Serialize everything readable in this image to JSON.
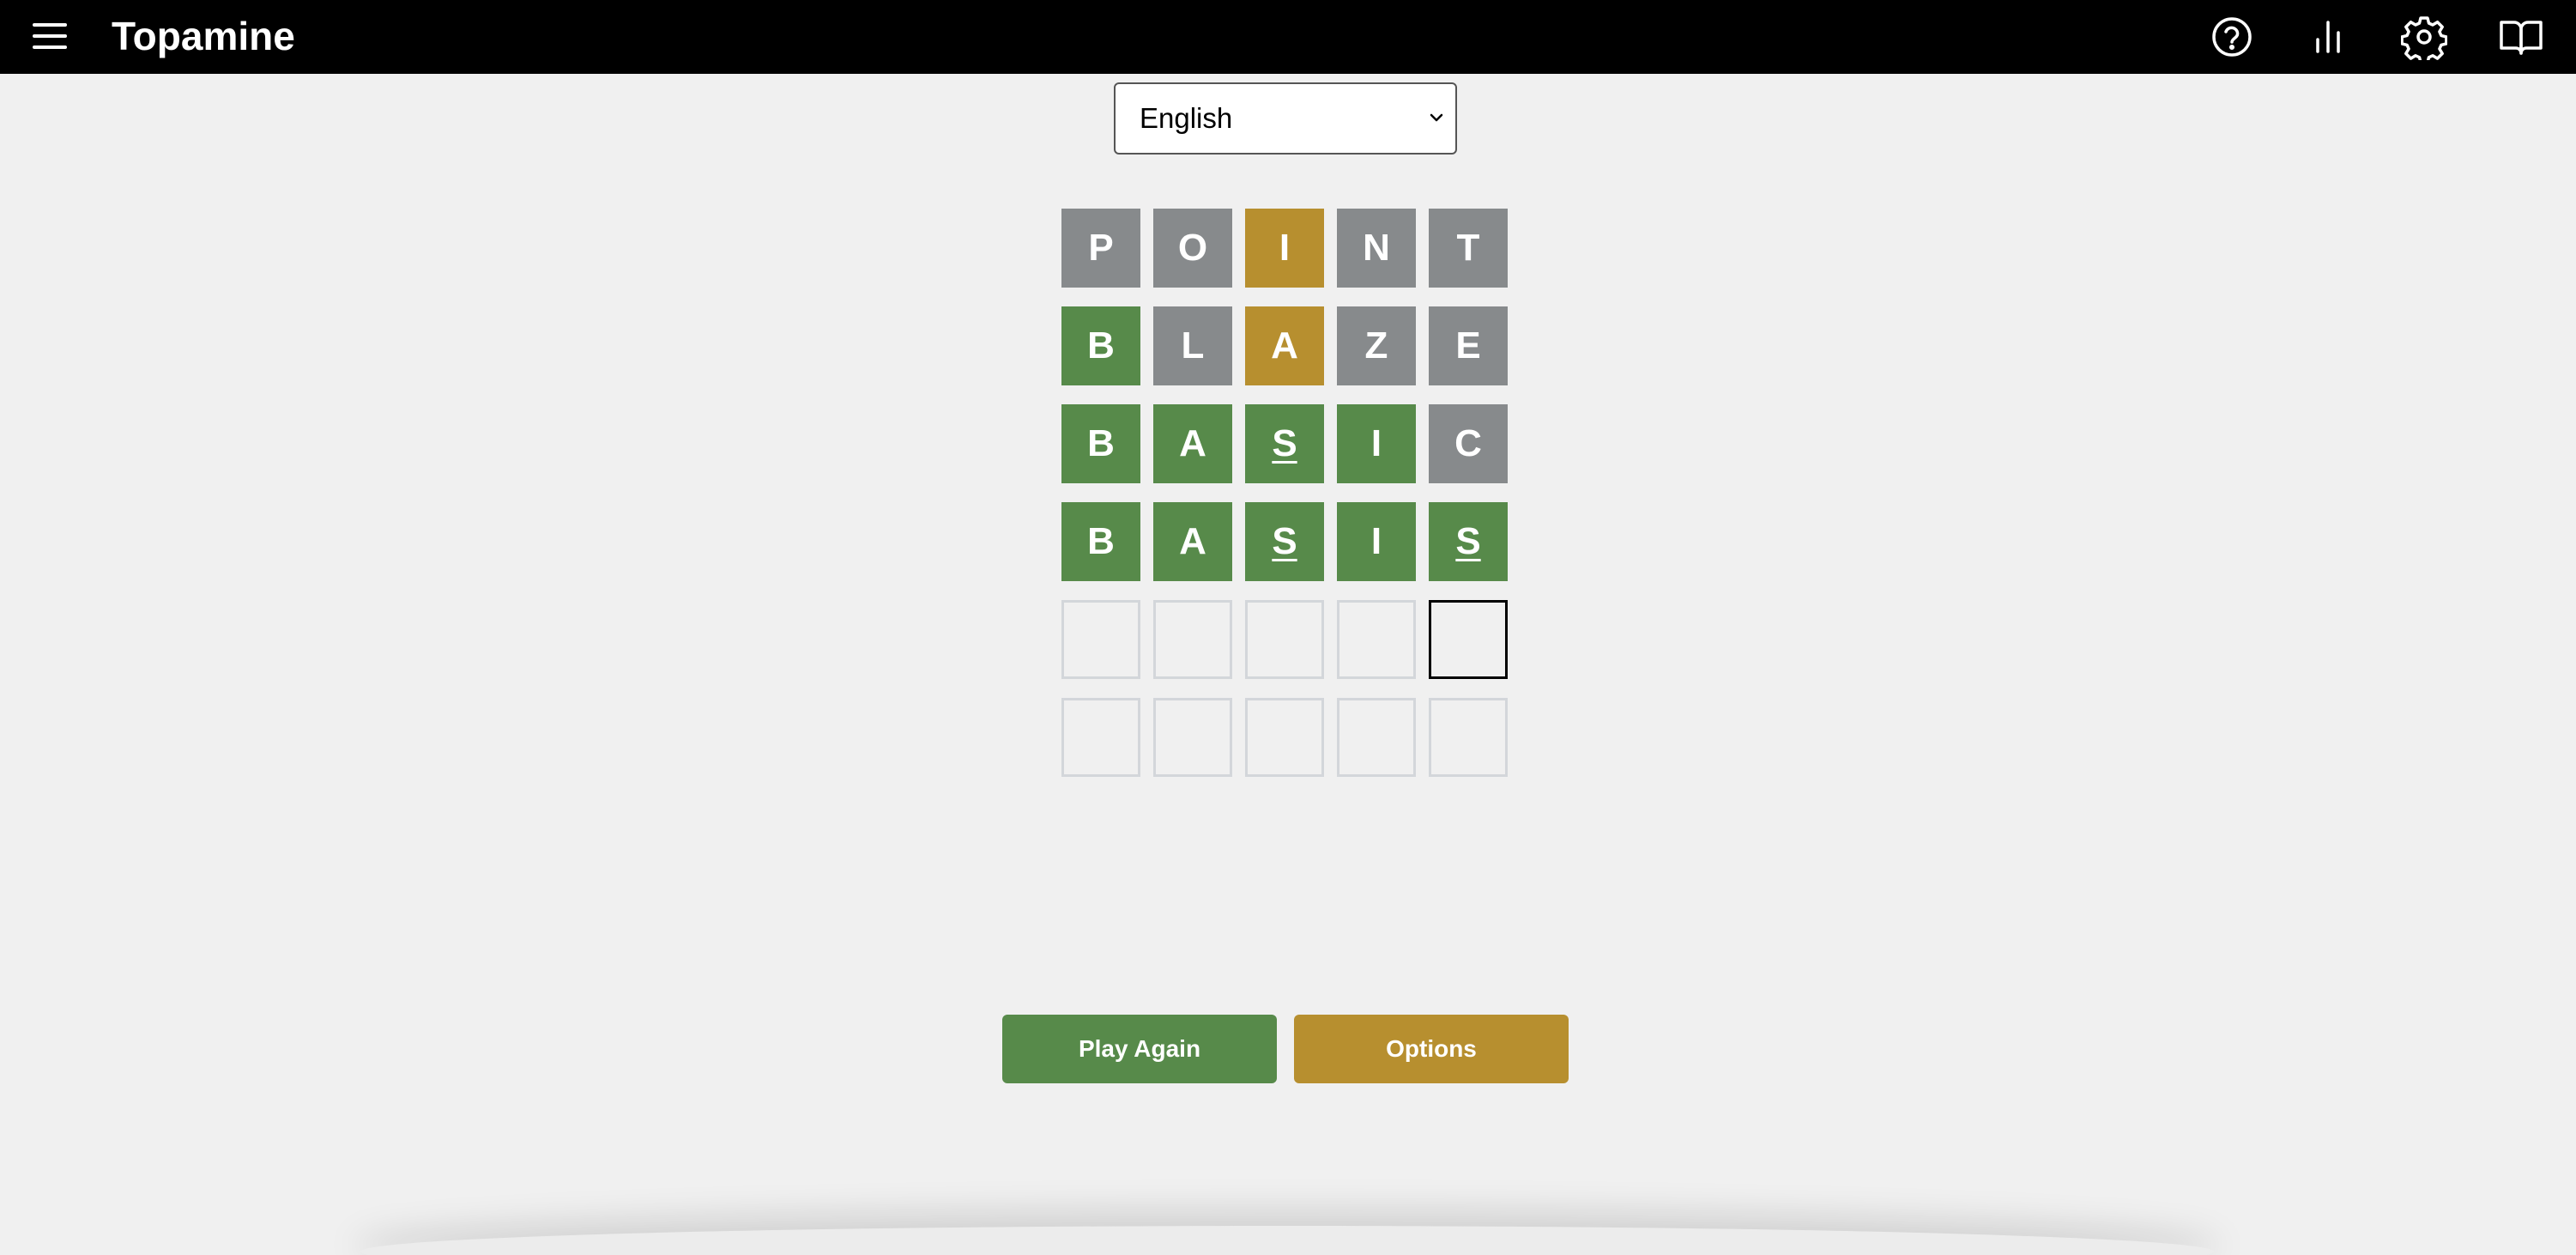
{
  "app": {
    "title": "Topamine"
  },
  "header": {
    "icons": [
      "menu-icon",
      "help-icon",
      "stats-icon",
      "settings-icon",
      "book-icon"
    ]
  },
  "language": {
    "selected": "English"
  },
  "colors": {
    "correct": "#578a4a",
    "present": "#b78f2f",
    "absent": "#878a8c",
    "topbar": "#000000",
    "background": "#f0f0f0"
  },
  "board": {
    "rows": [
      {
        "tiles": [
          {
            "letter": "P",
            "state": "absent"
          },
          {
            "letter": "O",
            "state": "absent"
          },
          {
            "letter": "I",
            "state": "present"
          },
          {
            "letter": "N",
            "state": "absent"
          },
          {
            "letter": "T",
            "state": "absent"
          }
        ]
      },
      {
        "tiles": [
          {
            "letter": "B",
            "state": "correct"
          },
          {
            "letter": "L",
            "state": "absent"
          },
          {
            "letter": "A",
            "state": "present"
          },
          {
            "letter": "Z",
            "state": "absent"
          },
          {
            "letter": "E",
            "state": "absent"
          }
        ]
      },
      {
        "tiles": [
          {
            "letter": "B",
            "state": "correct"
          },
          {
            "letter": "A",
            "state": "correct"
          },
          {
            "letter": "S",
            "state": "correct",
            "underlined": true
          },
          {
            "letter": "I",
            "state": "correct"
          },
          {
            "letter": "C",
            "state": "absent"
          }
        ]
      },
      {
        "tiles": [
          {
            "letter": "B",
            "state": "correct"
          },
          {
            "letter": "A",
            "state": "correct"
          },
          {
            "letter": "S",
            "state": "correct",
            "underlined": true
          },
          {
            "letter": "I",
            "state": "correct"
          },
          {
            "letter": "S",
            "state": "correct",
            "underlined": true
          }
        ]
      },
      {
        "tiles": [
          {
            "letter": "",
            "state": "empty"
          },
          {
            "letter": "",
            "state": "empty"
          },
          {
            "letter": "",
            "state": "empty"
          },
          {
            "letter": "",
            "state": "empty"
          },
          {
            "letter": "",
            "state": "active"
          }
        ]
      },
      {
        "tiles": [
          {
            "letter": "",
            "state": "empty"
          },
          {
            "letter": "",
            "state": "empty"
          },
          {
            "letter": "",
            "state": "empty"
          },
          {
            "letter": "",
            "state": "empty"
          },
          {
            "letter": "",
            "state": "empty"
          }
        ]
      }
    ]
  },
  "actions": {
    "play_again": "Play Again",
    "options": "Options"
  }
}
